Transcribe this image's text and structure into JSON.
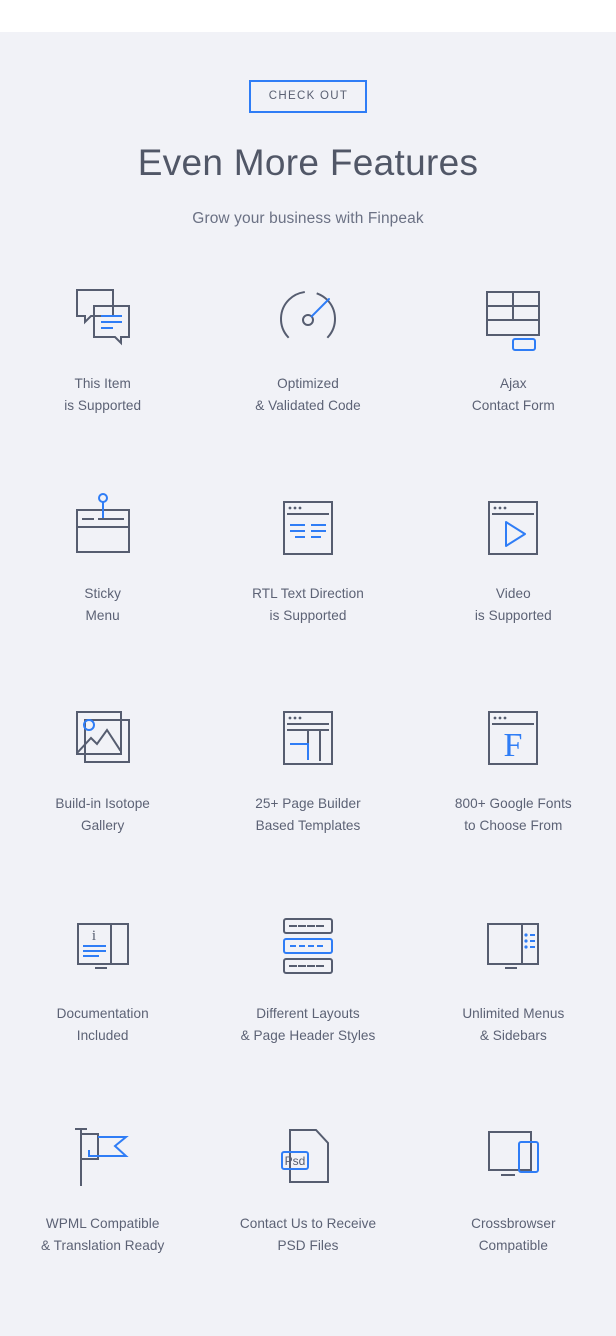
{
  "header": {
    "badge_label": "CHECK OUT",
    "title": "Even More Features",
    "subtitle": "Grow your business with Finpeak"
  },
  "theme": {
    "page_background": "#ffffff",
    "section_background": "#f1f2f7",
    "accent_color": "#2f7df6",
    "icon_stroke_color": "#565d70",
    "text_color": "#5c6275",
    "title_color": "#515767"
  },
  "features": [
    {
      "icon": "chat-bubbles-icon",
      "line1": "This Item",
      "line2": "is Supported"
    },
    {
      "icon": "speedometer-icon",
      "line1": "Optimized",
      "line2": "& Validated Code"
    },
    {
      "icon": "contact-form-icon",
      "line1": "Ajax",
      "line2": "Contact Form"
    },
    {
      "icon": "sticky-pin-window-icon",
      "line1": "Sticky",
      "line2": "Menu"
    },
    {
      "icon": "rtl-text-window-icon",
      "line1": "RTL Text Direction",
      "line2": "is Supported"
    },
    {
      "icon": "video-play-window-icon",
      "line1": "Video",
      "line2": "is Supported"
    },
    {
      "icon": "photo-stack-icon",
      "line1": "Build-in Isotope",
      "line2": "Gallery"
    },
    {
      "icon": "page-builder-icon",
      "line1": "25+ Page Builder",
      "line2": "Based Templates"
    },
    {
      "icon": "font-f-window-icon",
      "line1": "800+ Google Fonts",
      "line2": "to Choose From"
    },
    {
      "icon": "open-book-info-icon",
      "line1": "Documentation",
      "line2": "Included"
    },
    {
      "icon": "header-layouts-icon",
      "line1": "Different Layouts",
      "line2": "& Page Header Styles"
    },
    {
      "icon": "sidebar-menu-icon",
      "line1": "Unlimited Menus",
      "line2": "& Sidebars"
    },
    {
      "icon": "flag-icon",
      "line1": "WPML Compatible",
      "line2": "& Translation Ready"
    },
    {
      "icon": "psd-document-icon",
      "line1": "Contact Us to Receive",
      "line2": "PSD Files"
    },
    {
      "icon": "monitor-phone-icon",
      "line1": "Crossbrowser",
      "line2": "Compatible"
    }
  ],
  "icon_badge_labels": {
    "psd_badge": "Psd",
    "info_letter": "i",
    "font_letter": "F"
  }
}
